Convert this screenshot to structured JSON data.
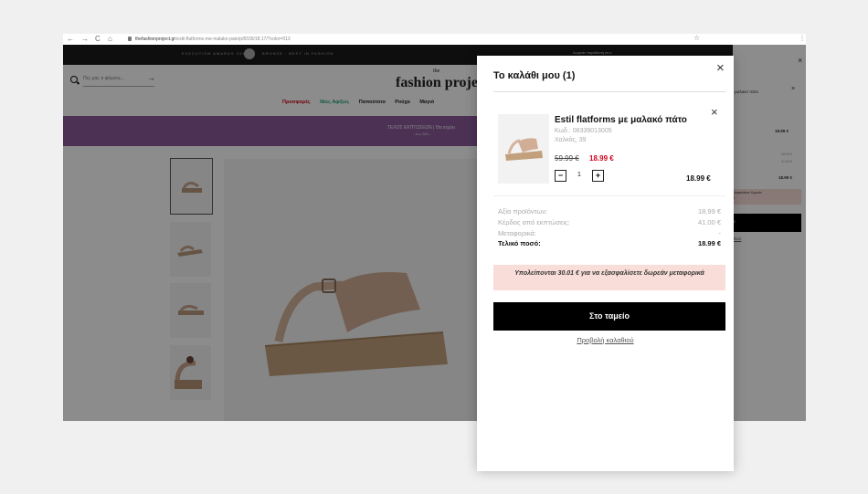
{
  "browser": {
    "nav": [
      "←",
      "→",
      "C",
      "⌂"
    ],
    "url_host": "thefashionproject.gr",
    "url_path": "/estil-flatforms-me-malako-pato/p/8339/18.17/?color=013",
    "star": "☆",
    "kebab": "⋮"
  },
  "site": {
    "award_text": "EXECUTION AWARDS 2019",
    "award_text2": "BRONZE · BEST IN FASHION",
    "shipping_note": "Δωρεάν παράδοση σε κ",
    "search_placeholder": "Πες μας τι ψάχνεις...",
    "search_arrow": "→",
    "logo_the": "the",
    "logo": "fashion projec",
    "nav": [
      {
        "label": "Προσφορές",
        "color": "#d0021b"
      },
      {
        "label": "Νέες Αφίξεις",
        "color": "#1fa07a"
      },
      {
        "label": "Παπούτσια",
        "color": "#222"
      },
      {
        "label": "Ρούχα",
        "color": "#222"
      },
      {
        "label": "Μαγιό",
        "color": "#222"
      }
    ],
    "promo_text": "ΤΕΛΟΣ ΕΚΠΤΩΣΕΩΝ | Θα ισχύει",
    "promo_sub": "...έως 30/9...",
    "promo_color": "#8a5a9c",
    "side_panel": {
      "item_name": "ι μαλακό πάτο",
      "close": "×",
      "close2": "×",
      "price": "18.99 €",
      "price_small_1": "18.99 €",
      "price_small_2": "41.00 €",
      "total": "18.99 €",
      "notice": "ξασφαλίσετε δωρεάν",
      "notice2": "ά",
      "button": "ο",
      "link": "ιθιού"
    }
  },
  "cart": {
    "title": "Το καλάθι μου (1)",
    "close": "×",
    "item": {
      "name": "Estil flatforms με μαλακό πάτο",
      "code": "Κωδ.: 08339013005",
      "variant": "Χαλκός, 39",
      "old_price": "59.99 €",
      "new_price": "18.99 €",
      "quantity": "1",
      "minus": "−",
      "plus": "+",
      "line_total": "18.99 €",
      "remove": "×"
    },
    "summary": [
      {
        "label": "Αξία προϊόντων:",
        "value": "18.99 €"
      },
      {
        "label": "Κέρδος από εκπτώσεις:",
        "value": "41.00 €"
      },
      {
        "label": "Μεταφορικά:",
        "value": "-"
      },
      {
        "label": "Τελικό ποσό:",
        "value": "18.99 €"
      }
    ],
    "notice": "Υπολείπονται 30.01 € για να εξασφαλίσετε δωρεάν μεταφορικά",
    "checkout_label": "Στο ταμείο",
    "view_cart_label": "Προβολή καλαθιού",
    "accent_price_color": "#d0021b",
    "notice_bg": "#f8ddd8"
  }
}
